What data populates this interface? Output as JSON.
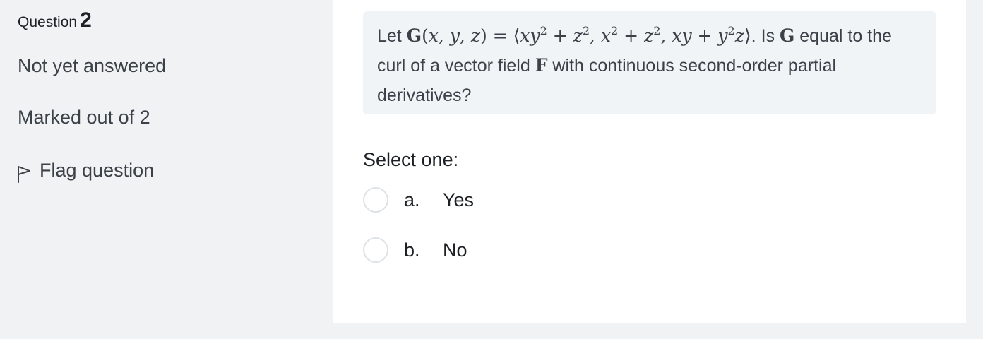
{
  "question_info": {
    "label": "Question",
    "number": "2",
    "state": "Not yet answered",
    "grade": "Marked out of 2",
    "flag_label": "Flag question",
    "flag_icon": "flag-outline-icon"
  },
  "question": {
    "text_before": "Let ",
    "text_mid": ". Is ",
    "text_after_g": " equal to the curl of a vector field ",
    "text_end": " with continuous second-order partial derivatives?",
    "vector_g": "G",
    "vector_f": "F",
    "formula": "G(x, y, z) = ⟨xy² + z², x² + z², xy + y²z⟩"
  },
  "answer": {
    "prompt": "Select one:",
    "options": [
      {
        "letter": "a.",
        "text": "Yes"
      },
      {
        "letter": "b.",
        "text": "No"
      }
    ]
  },
  "colors": {
    "page_background": "#f1f2f4",
    "content_background": "#ffffff",
    "question_box": "#f1f4f7",
    "text": "#1d2125",
    "muted_text": "#3b4148",
    "radio_border": "#dee2e6"
  }
}
